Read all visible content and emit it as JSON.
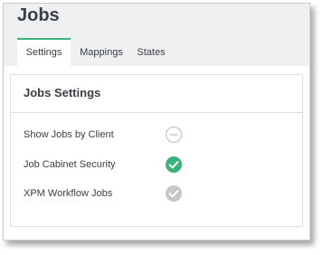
{
  "page": {
    "title": "Jobs"
  },
  "tabs": [
    {
      "label": "Settings",
      "active": true
    },
    {
      "label": "Mappings",
      "active": false
    },
    {
      "label": "States",
      "active": false
    }
  ],
  "panel": {
    "title": "Jobs Settings",
    "rows": [
      {
        "label": "Show Jobs by Client",
        "status": "minus-circle-icon"
      },
      {
        "label": "Job Cabinet Security",
        "status": "check-circle-green-icon"
      },
      {
        "label": "XPM Workflow Jobs",
        "status": "check-circle-gray-icon"
      }
    ]
  },
  "colors": {
    "accent": "#3bb27a",
    "check_green": "#3bb27a",
    "check_gray": "#c5c8cb",
    "minus_outline": "#c5c8cb"
  }
}
